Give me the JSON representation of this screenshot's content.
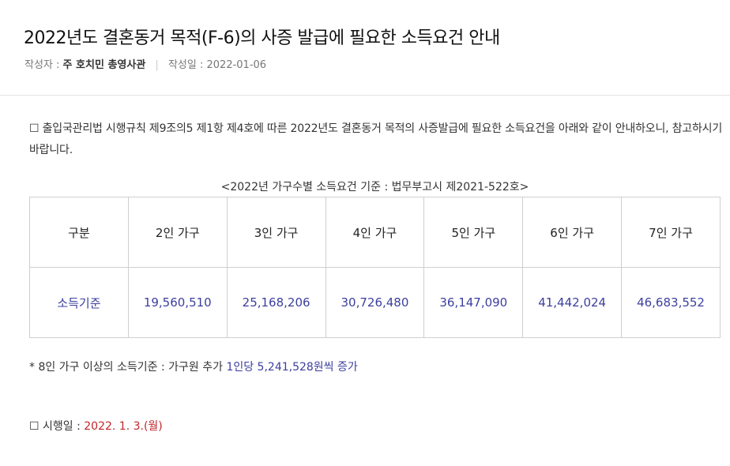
{
  "article": {
    "title": "2022년도 결혼동거 목적(F-6)의 사증 발급에 필요한 소득요건 안내",
    "author_label": "작성자 :",
    "author": "주 호치민 총영사관",
    "date_label": "작성일 :",
    "date": "2022-01-06"
  },
  "body": {
    "intro": "☐ 출입국관리법 시행규칙 제9조의5 제1항 제4호에 따른 2022년도 결혼동거 목적의 사증발급에 필요한 소득요건을 아래와 같이 안내하오니, 참고하시기 바랍니다.",
    "table_caption": "<2022년 가구수별 소득요건 기준 : 법무부고시 제2021-522호>",
    "table": {
      "headers": [
        "구분",
        "2인 가구",
        "3인 가구",
        "4인 가구",
        "5인 가구",
        "6인 가구",
        "7인 가구"
      ],
      "row": [
        "소득기준",
        "19,560,510",
        "25,168,206",
        "30,726,480",
        "36,147,090",
        "41,442,024",
        "46,683,552"
      ]
    },
    "note_prefix": "* 8인 가구 이상의 소득기준 : 가구원 추가",
    "note_highlight": "1인당 5,241,528원씩 증가",
    "effective_label": "☐ 시행일 :",
    "effective_date": "2022. 1. 3.(월)"
  }
}
